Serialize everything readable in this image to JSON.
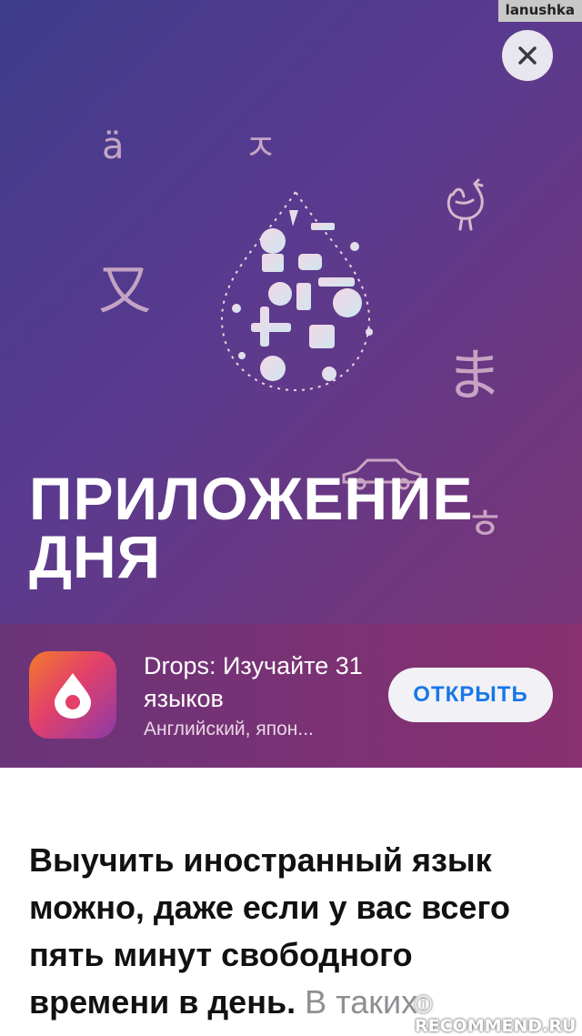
{
  "watermark": "lanushka",
  "hero": {
    "title_line1": "ПРИЛОЖЕНИЕ",
    "title_line2": "ДНЯ",
    "floating_glyphs": [
      "ä",
      "ㅈ",
      "又",
      "ま",
      "ㅎ"
    ],
    "close_icon": "close-icon",
    "rooster_icon": "rooster-icon",
    "car_icon": "car-icon",
    "drop_art_icon": "language-drop-illustration"
  },
  "app": {
    "name": "Drops: Изучайте 31 языков",
    "subtitle": "Английский, япон...",
    "open_label": "ОТКРЫТЬ",
    "icon": "drops-app-icon"
  },
  "article": {
    "lead": "Выучить иностранный язык можно, даже если у вас всего пять минут свободного времени в день.",
    "rest": " В таких"
  },
  "site_watermark": "RECOMMEND.RU",
  "colors": {
    "accent": "#1878e6",
    "hero_start": "#3f3c8c",
    "hero_end": "#7a3577"
  }
}
